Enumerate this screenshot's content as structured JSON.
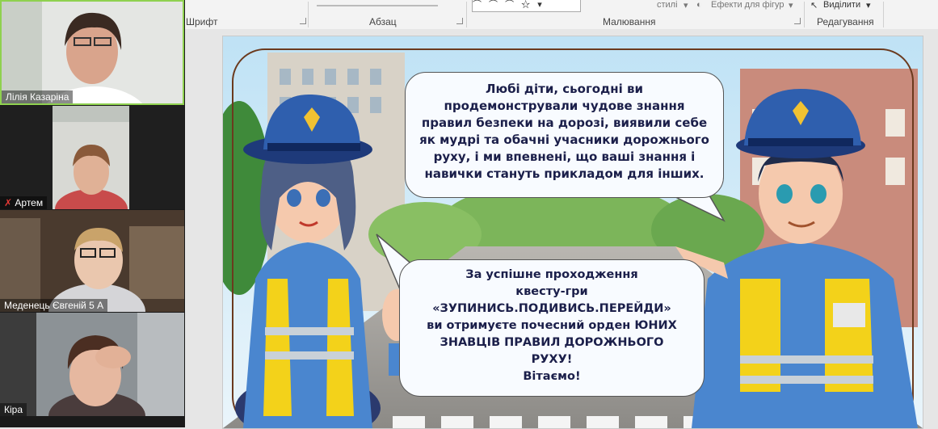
{
  "ribbon": {
    "font_label": "Шрифт",
    "paragraph_label": "Абзац",
    "drawing_label": "Малювання",
    "styles_text": "стилі",
    "shape_effects_text": "Ефекти для фігур",
    "select_text": "Виділити",
    "editing_label": "Редагування"
  },
  "participants": [
    {
      "name": "Лілія Казаріна",
      "muted": false
    },
    {
      "name": "Артем",
      "muted": true
    },
    {
      "name": "Меденець Євгеній 5 А",
      "muted": false
    },
    {
      "name": "Кіра",
      "muted": false
    }
  ],
  "slide": {
    "bubble_top": [
      "Любі діти, сьогодні ви",
      "продемонстрували чудове знання",
      "правил безпеки на дорозі, виявили себе",
      "як мудрі та обачні учасники дорожнього",
      "руху, і ми впевнені, що ваші знання і",
      "навички стануть прикладом для інших."
    ],
    "bubble_bottom": [
      "За успішне проходження",
      "квесту-гри",
      "«ЗУПИНИСЬ.ПОДИВИСЬ.ПЕРЕЙДИ»",
      "ви отримуєте почесний орден ЮНИХ",
      "ЗНАВЦІВ ПРАВИЛ ДОРОЖНЬОГО",
      "РУХУ!",
      "Вітаємо!"
    ]
  },
  "colors": {
    "police_blue": "#2f6db8",
    "vest_yellow": "#f3d21a",
    "bubble_text": "#1b1f4a"
  }
}
